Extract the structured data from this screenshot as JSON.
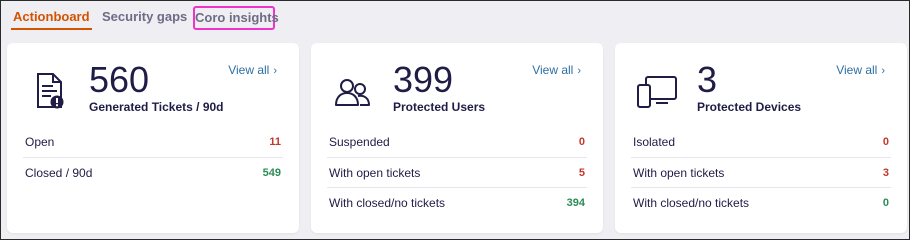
{
  "tabs": [
    {
      "label": "Actionboard",
      "active": true
    },
    {
      "label": "Security gaps",
      "active": false
    },
    {
      "label": "Coro insights",
      "active": false
    }
  ],
  "cards": [
    {
      "icon": "ticket-document-icon",
      "count": "560",
      "title": "Generated Tickets / 90d",
      "view_all": "View all",
      "rows": [
        {
          "label": "Open",
          "value": "11",
          "color": "#c0392b"
        },
        {
          "label": "Closed / 90d",
          "value": "549",
          "color": "#2e8b57"
        }
      ]
    },
    {
      "icon": "users-icon",
      "count": "399",
      "title": "Protected Users",
      "view_all": "View all",
      "rows": [
        {
          "label": "Suspended",
          "value": "0",
          "color": "#c0392b"
        },
        {
          "label": "With open tickets",
          "value": "5",
          "color": "#c0392b"
        },
        {
          "label": "With closed/no tickets",
          "value": "394",
          "color": "#2e8b57"
        }
      ]
    },
    {
      "icon": "devices-icon",
      "count": "3",
      "title": "Protected Devices",
      "view_all": "View all",
      "rows": [
        {
          "label": "Isolated",
          "value": "0",
          "color": "#c0392b"
        },
        {
          "label": "With open tickets",
          "value": "3",
          "color": "#c0392b"
        },
        {
          "label": "With closed/no tickets",
          "value": "0",
          "color": "#2e8b57"
        }
      ]
    }
  ],
  "colors": {
    "accent": "#d35400",
    "link": "#2d6fa3",
    "highlight": "#ee33cc"
  }
}
